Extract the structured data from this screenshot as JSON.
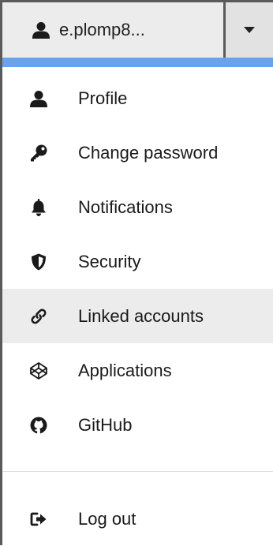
{
  "user_menu": {
    "username": "e.plomp8...",
    "user_icon": "user-icon",
    "caret_icon": "caret-down-icon"
  },
  "colors": {
    "accent": "#6aa3ec",
    "active_bg": "#ececec",
    "icon": "#1a1a1a"
  },
  "menu": {
    "items": [
      {
        "label": "Profile",
        "icon": "user-icon",
        "active": false
      },
      {
        "label": "Change password",
        "icon": "key-icon",
        "active": false
      },
      {
        "label": "Notifications",
        "icon": "bell-icon",
        "active": false
      },
      {
        "label": "Security",
        "icon": "shield-icon",
        "active": false
      },
      {
        "label": "Linked accounts",
        "icon": "link-icon",
        "active": true
      },
      {
        "label": "Applications",
        "icon": "codepen-icon",
        "active": false
      },
      {
        "label": "GitHub",
        "icon": "github-icon",
        "active": false
      }
    ],
    "logout": {
      "label": "Log out",
      "icon": "sign-out-icon"
    }
  }
}
